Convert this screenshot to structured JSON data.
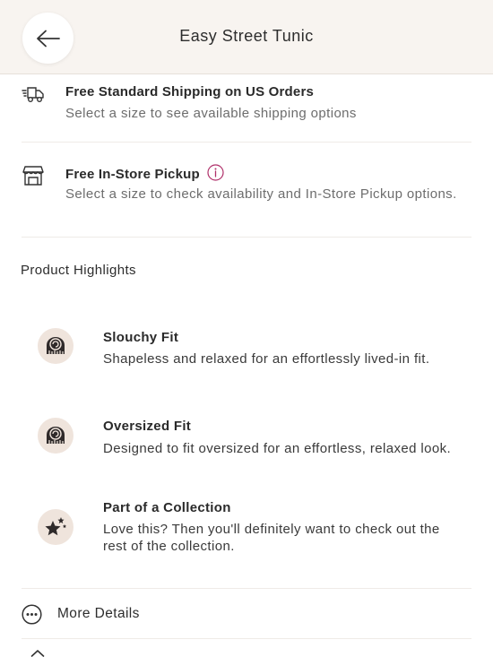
{
  "header": {
    "title": "Easy Street Tunic",
    "back_icon": "arrow-left-icon"
  },
  "shipping": {
    "standard": {
      "icon": "delivery-truck-icon",
      "title": "Free Standard Shipping on US Orders",
      "subtitle": "Select a size to see available shipping options"
    },
    "pickup": {
      "icon": "storefront-icon",
      "title": "Free In-Store Pickup",
      "info_icon": "info-icon",
      "subtitle": "Select a size to check availability and In-Store Pickup options."
    }
  },
  "highlights": {
    "section_title": "Product Highlights",
    "items": [
      {
        "icon": "measuring-tape-icon",
        "title": "Slouchy Fit",
        "description": "Shapeless and relaxed for an effortlessly lived-in fit."
      },
      {
        "icon": "measuring-tape-icon",
        "title": "Oversized Fit",
        "description": "Designed to fit oversized for an effortless, relaxed look."
      },
      {
        "icon": "stars-icon",
        "title": "Part of a Collection",
        "description": "Love this? Then you'll definitely want to check out the rest of the collection."
      }
    ]
  },
  "more_details": {
    "icon": "more-dots-icon",
    "label": "More Details"
  },
  "colors": {
    "header_bg": "#f8f4f0",
    "icon_circle_bg": "#efe4dc",
    "info_accent": "#b0306a",
    "text_primary": "#2a2a2a",
    "text_secondary": "#6d6d6d"
  }
}
